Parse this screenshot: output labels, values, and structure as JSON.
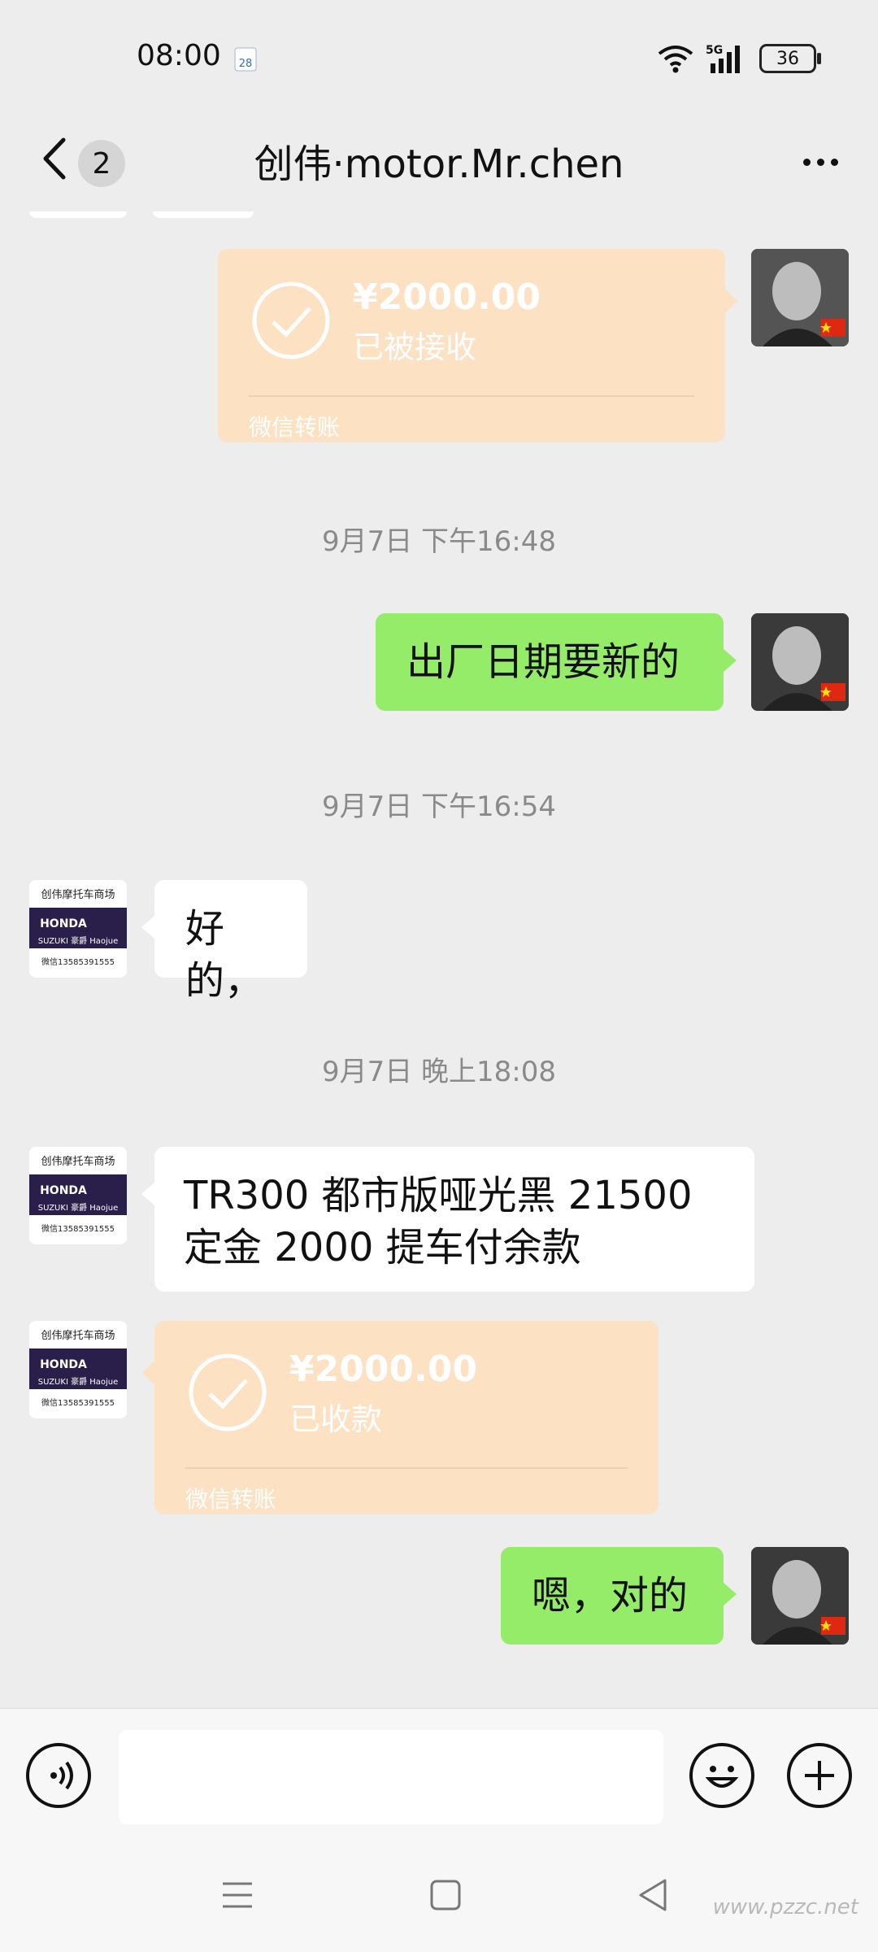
{
  "status_bar": {
    "time": "08:00",
    "calendar_day": "28",
    "network": "5G",
    "battery": "36"
  },
  "header": {
    "back_count": "2",
    "title": "创伟·motor.Mr.chen"
  },
  "messages": {
    "transfer_sent": {
      "amount": "¥2000.00",
      "status": "已被接收",
      "footer": "微信转账"
    },
    "ts1": "9月7日 下午16:48",
    "msg_date_new": "出厂日期要新的",
    "ts2": "9月7日 下午16:54",
    "msg_ok": "好的，",
    "ts3": "9月7日 晚上18:08",
    "msg_price_line1": "TR300 都市版哑光黑  21500",
    "msg_price_line2": "定金 2000 提车付余款",
    "transfer_received": {
      "amount": "¥2000.00",
      "status": "已收款",
      "footer": "微信转账"
    },
    "msg_confirm": "嗯，对的"
  },
  "shop_avatar": {
    "line1": "创伟摩托车商场",
    "line2": "HONDA",
    "line3": "SUZUKI 豪爵 Haojue",
    "line4": "微信13585391555"
  },
  "watermark": "www.pzzc.net",
  "colors": {
    "background": "#ededed",
    "bubble_green": "#95ec69",
    "transfer_orange": "#fde1c3"
  }
}
